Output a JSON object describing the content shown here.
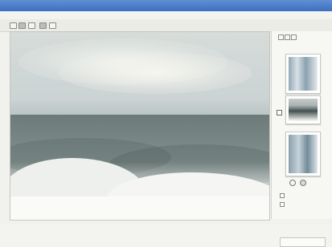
{
  "window": {
    "title": "",
    "menu_items": [
      "",
      "",
      "",
      "",
      "",
      ""
    ],
    "toolbar_labels": [
      "",
      ""
    ]
  },
  "sidebar": {
    "title": "",
    "options": [
      "",
      ""
    ],
    "button": ""
  },
  "icons": [
    "window-icon",
    "back-icon",
    "forward-icon",
    "print-icon",
    "zoom-icon",
    "rotate-icon"
  ]
}
